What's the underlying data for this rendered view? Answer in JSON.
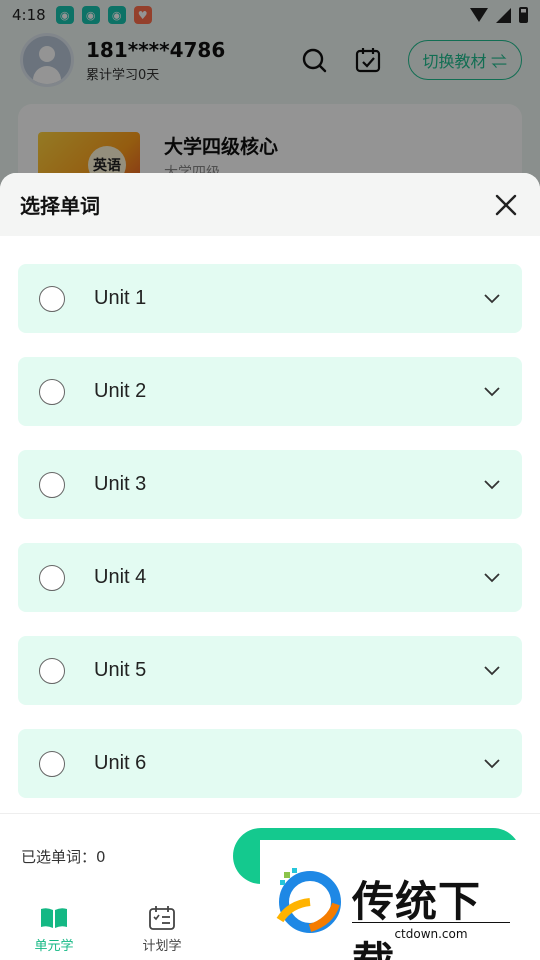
{
  "status_bar": {
    "time": "4:18",
    "apps": [
      "app-icon-1",
      "app-icon-2",
      "app-icon-3",
      "app-icon-4"
    ]
  },
  "profile": {
    "phone": "181****4786",
    "study_days": "累计学习0天",
    "switch_label": "切换教材 ⇌"
  },
  "book": {
    "cover_label": "英语",
    "title": "大学四级核心",
    "subtitle": "大学四级"
  },
  "sheet": {
    "title": "选择单词",
    "units": [
      {
        "label": "Unit 1"
      },
      {
        "label": "Unit 2"
      },
      {
        "label": "Unit 3"
      },
      {
        "label": "Unit 4"
      },
      {
        "label": "Unit 5"
      },
      {
        "label": "Unit 6"
      }
    ],
    "selected_count_label": "已选单词：0"
  },
  "tabs": [
    {
      "label": "单元学",
      "active": true
    },
    {
      "label": "计划学",
      "active": false
    }
  ],
  "watermark": {
    "title": "传统下载",
    "url": "ctdown.com"
  },
  "colors": {
    "accent": "#14c98e",
    "unit_bg": "#e3fbf2"
  }
}
